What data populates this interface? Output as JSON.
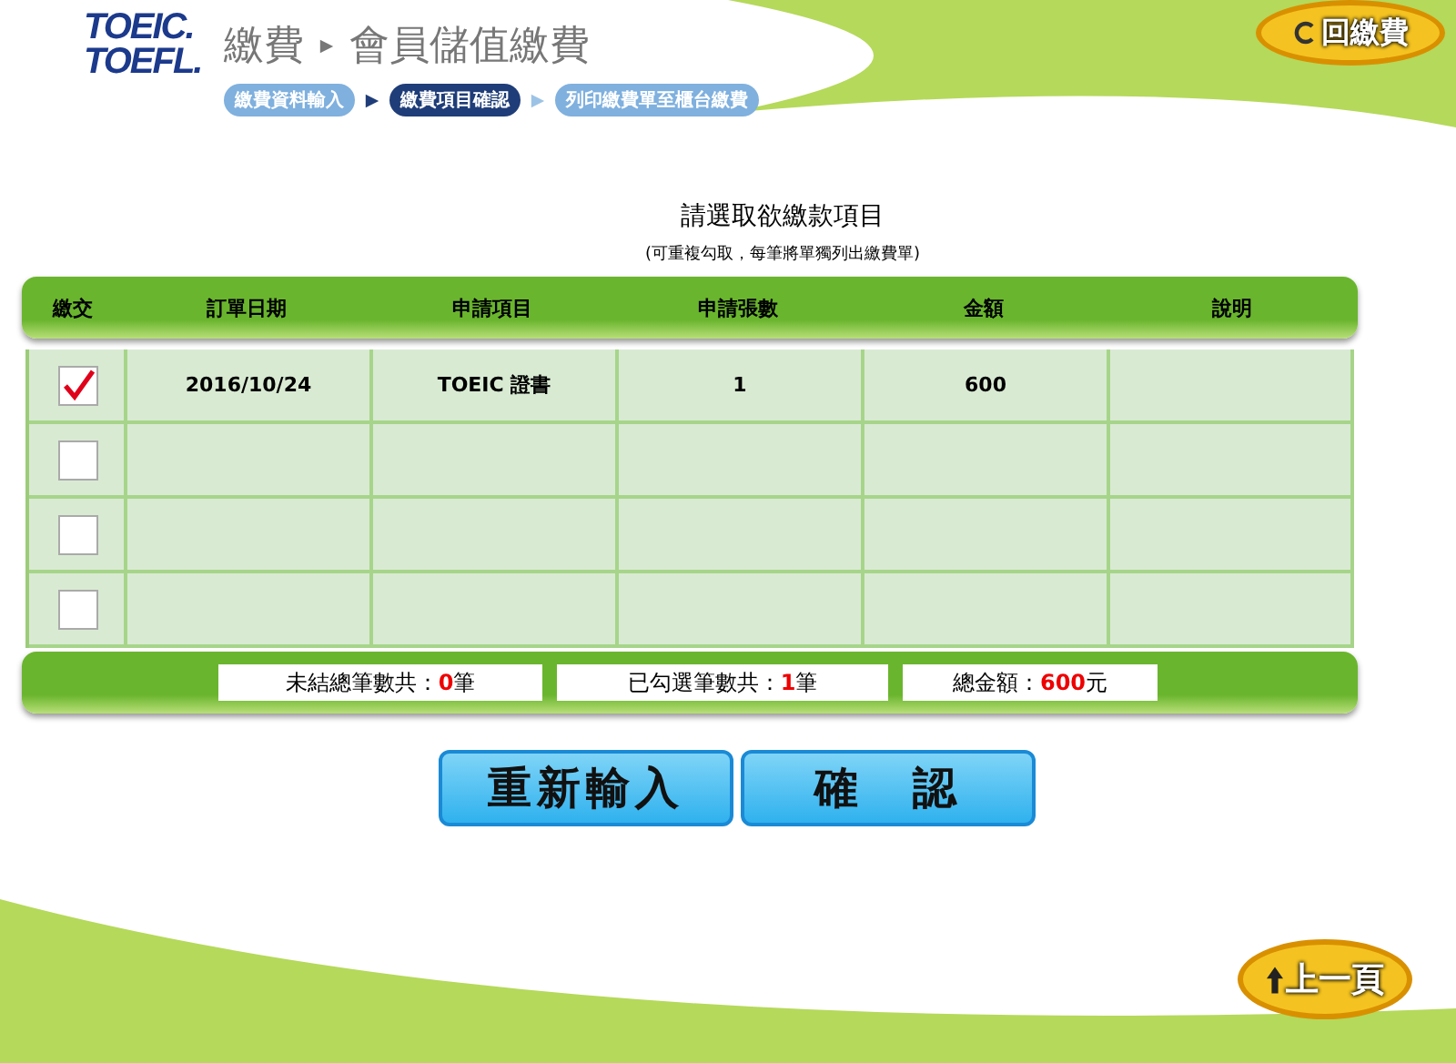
{
  "header": {
    "logo_lines": [
      "TOEIC.",
      "TOEFL."
    ],
    "breadcrumb": [
      "繳費",
      "會員儲值繳費"
    ],
    "back_to_payment": "回繳費"
  },
  "steps": [
    {
      "label": "繳費資料輸入",
      "selected": false
    },
    {
      "label": "繳費項目確認",
      "selected": true
    },
    {
      "label": "列印繳費單至櫃台繳費",
      "selected": false
    }
  ],
  "title": "請選取欲繳款項目",
  "subtitle": "(可重複勾取，每筆將單獨列出繳費單)",
  "table": {
    "check_column": "繳交",
    "columns": [
      "訂單日期",
      "申請項目",
      "申請張數",
      "金額",
      "說明"
    ],
    "rows": [
      {
        "checked": true,
        "cells": [
          "2016/10/24",
          "TOEIC 證書",
          "1",
          "600",
          ""
        ]
      },
      {
        "checked": false,
        "cells": [
          "",
          "",
          "",
          "",
          ""
        ]
      },
      {
        "checked": false,
        "cells": [
          "",
          "",
          "",
          "",
          ""
        ]
      },
      {
        "checked": false,
        "cells": [
          "",
          "",
          "",
          "",
          ""
        ]
      }
    ]
  },
  "summary": [
    {
      "label": "未結總筆數共：",
      "value": "0",
      "unit": "筆"
    },
    {
      "label": "已勾選筆數共：",
      "value": "1",
      "unit": "筆"
    },
    {
      "label": "總金額：",
      "value": "600",
      "unit": " 元"
    }
  ],
  "buttons": [
    "重新輸入",
    "確　認"
  ],
  "previous_page": "上一頁"
}
